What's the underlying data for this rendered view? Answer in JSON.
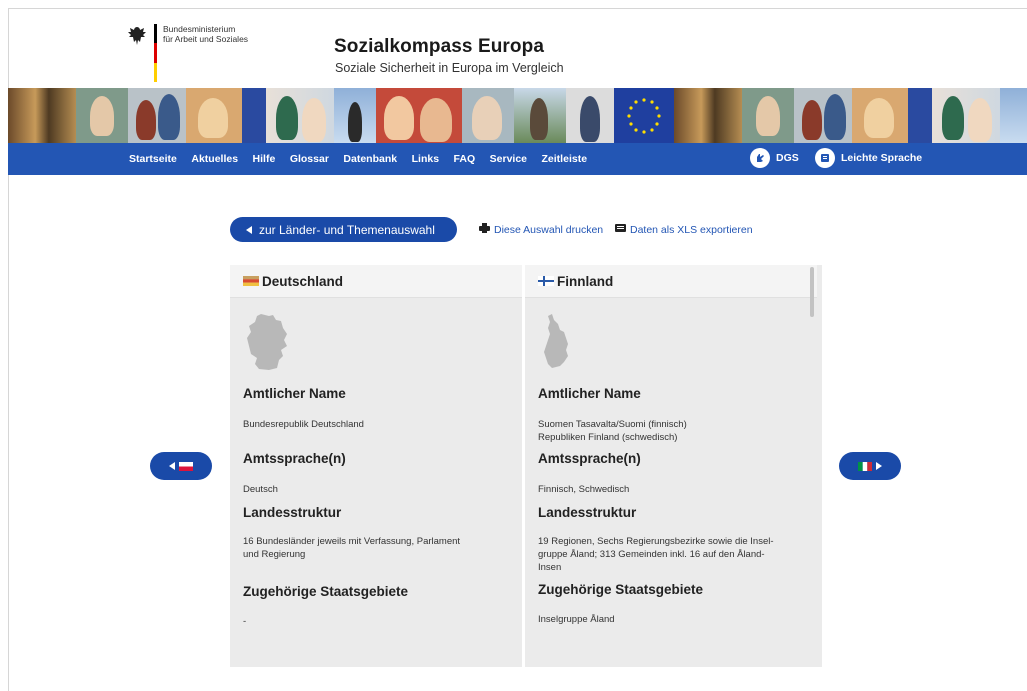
{
  "header": {
    "ministry_line1": "Bundesministerium",
    "ministry_line2": "für Arbeit und Soziales",
    "title": "Sozialkompass Europa",
    "subtitle": "Soziale Sicherheit in Europa im Vergleich"
  },
  "nav": {
    "items": [
      "Startseite",
      "Aktuelles",
      "Hilfe",
      "Glossar",
      "Datenbank",
      "Links",
      "FAQ",
      "Service",
      "Zeitleiste"
    ],
    "dgs_label": "DGS",
    "easy_language_label": "Leichte Sprache"
  },
  "actions": {
    "back_label": "zur Länder- und Themenauswahl",
    "print_label": "Diese Auswahl drucken",
    "export_label": "Daten als XLS exportieren"
  },
  "countries": [
    {
      "name": "Deutschland",
      "sections": [
        {
          "title": "Amtlicher Name",
          "lines": [
            "Bundesrepublik Deutschland"
          ]
        },
        {
          "title": "Amtssprache(n)",
          "lines": [
            "Deutsch"
          ]
        },
        {
          "title": "Landesstruktur",
          "lines": [
            "16 Bundesländer jeweils mit Verfassung, Parlament",
            "und Regierung"
          ]
        },
        {
          "title": "Zugehörige Staatsgebiete",
          "lines": [
            "-"
          ]
        }
      ]
    },
    {
      "name": "Finnland",
      "sections": [
        {
          "title": "Amtlicher Name",
          "lines": [
            "Suomen Tasavalta/Suomi (finnisch)",
            "Republiken Finland (schwedisch)"
          ]
        },
        {
          "title": "Amtssprache(n)",
          "lines": [
            "Finnisch, Schwedisch"
          ]
        },
        {
          "title": "Landesstruktur",
          "lines": [
            "19 Regionen, Sechs Regierungsbezirke sowie die Insel-",
            "gruppe Åland; 313 Gemeinden inkl. 16 auf den Åland-",
            "Insen"
          ]
        },
        {
          "title": "Zugehörige Staatsgebiete",
          "lines": [
            "Inselgruppe Åland"
          ]
        }
      ]
    }
  ],
  "colors": {
    "nav_blue": "#2356b4",
    "button_blue": "#1a4aa8",
    "panel_gray": "#ebebeb"
  }
}
